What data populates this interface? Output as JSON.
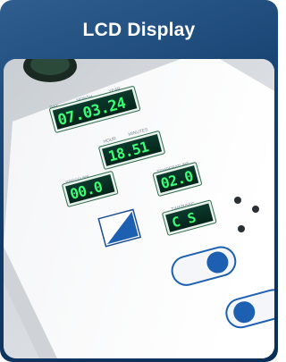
{
  "card": {
    "title": "LCD Display"
  },
  "photo": {
    "displays": {
      "date": "07.03.24",
      "time": "18.51",
      "pressure": "00.0",
      "temperature": "02.0",
      "timer": "C  S"
    },
    "labels": {
      "day": "DAY",
      "month": "MONTH",
      "year": "YEAR",
      "hour": "HOUR",
      "minutes": "MINUTES",
      "pressure": "PRESSURE",
      "temperature": "TEMPERATURE",
      "timer": "TIMER/SEC"
    }
  },
  "colors": {
    "brand_blue": "#123e6c",
    "lcd_green": "#3cff78",
    "button_blue": "#1d5fb0"
  }
}
